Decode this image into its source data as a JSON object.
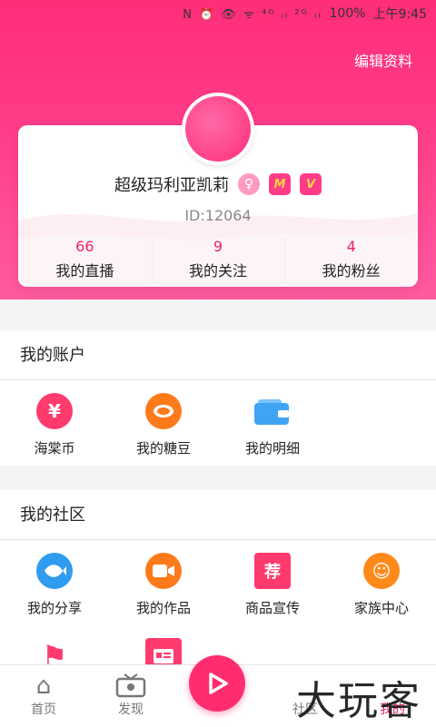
{
  "status_bar": {
    "icons": "N ⏰ 👁 ᯤ ⁴ᴳ ᵢₗ ²ᴳ ᵢₗ",
    "battery": "100%",
    "time": "上午9:45"
  },
  "header": {
    "edit_profile": "编辑资料"
  },
  "profile": {
    "name": "超级玛利亚凯莉",
    "gender_symbol": "♀",
    "badge_m": "M",
    "badge_v": "V",
    "uid": "ID:12064",
    "stats": [
      {
        "value": "66",
        "label": "我的直播"
      },
      {
        "value": "9",
        "label": "我的关注"
      },
      {
        "value": "4",
        "label": "我的粉丝"
      }
    ]
  },
  "account": {
    "title": "我的账户",
    "items": [
      {
        "label": "海棠币",
        "icon": "yen-icon",
        "glyph": "¥",
        "color": "#ff3b6e"
      },
      {
        "label": "我的糖豆",
        "icon": "bean-icon",
        "glyph": "●",
        "color": "#ff7a1a"
      },
      {
        "label": "我的明细",
        "icon": "wallet-icon",
        "glyph": "▭",
        "color": "#3fa4f5"
      }
    ]
  },
  "community": {
    "title": "我的社区",
    "items": [
      {
        "label": "我的分享",
        "icon": "share-fish-icon",
        "glyph": "🐟",
        "color": "#2f9cf0"
      },
      {
        "label": "我的作品",
        "icon": "video-icon",
        "glyph": "▶",
        "color": "#ff7a1a"
      },
      {
        "label": "商品宣传",
        "icon": "recommend-icon",
        "glyph": "荐",
        "color": "#ff3b6e"
      },
      {
        "label": "家族中心",
        "icon": "family-icon",
        "glyph": "☺",
        "color": "#ff8a1a"
      },
      {
        "label": "",
        "icon": "flag-icon",
        "glyph": "⚑",
        "color": "#ff3b6e"
      },
      {
        "label": "",
        "icon": "id-card-icon",
        "glyph": "▣",
        "color": "#ff3b6e"
      }
    ]
  },
  "nav": [
    {
      "label": "首页",
      "icon": "home-icon",
      "glyph": "⌂"
    },
    {
      "label": "发现",
      "icon": "tv-icon",
      "glyph": "📺"
    },
    {
      "label": "",
      "icon": "live-play-icon",
      "glyph": ""
    },
    {
      "label": "社区",
      "icon": "community-icon",
      "glyph": ""
    },
    {
      "label": "我的",
      "icon": "me-icon",
      "glyph": ""
    }
  ],
  "watermark": "大玩客"
}
